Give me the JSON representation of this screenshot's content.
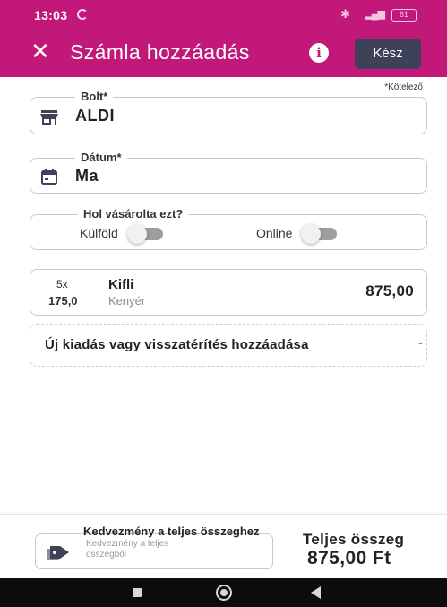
{
  "status_bar": {
    "time": "13:03",
    "battery": "61"
  },
  "app_bar": {
    "title": "Számla hozzáadás",
    "done_label": "Kész",
    "accent_color": "#c2187a",
    "done_color": "#3d4259"
  },
  "form": {
    "required_note": "*Kötelező",
    "store": {
      "label": "Bolt*",
      "value": "ALDI",
      "icon": "store-icon"
    },
    "date": {
      "label": "Dátum*",
      "value": "Ma",
      "icon": "calendar-icon"
    },
    "purchase_location": {
      "label": "Hol vásárolta ezt?",
      "options": [
        {
          "label": "Külföld",
          "on": false
        },
        {
          "label": "Online",
          "on": false
        }
      ]
    }
  },
  "items": [
    {
      "quantity": "5x",
      "unit_price": "175,0",
      "name": "Kifli",
      "category": "Kenyér",
      "amount": "875,00"
    }
  ],
  "add_expense": {
    "label": "Új kiadás vagy visszatérítés hozzáadása",
    "trailing": "-"
  },
  "summary": {
    "discount_title": "Kedvezmény a teljes összeghez",
    "discount_placeholder": "Kedvezmény a teljes összegből",
    "total_label": "Teljes összeg",
    "total_value": "875,00 Ft"
  }
}
